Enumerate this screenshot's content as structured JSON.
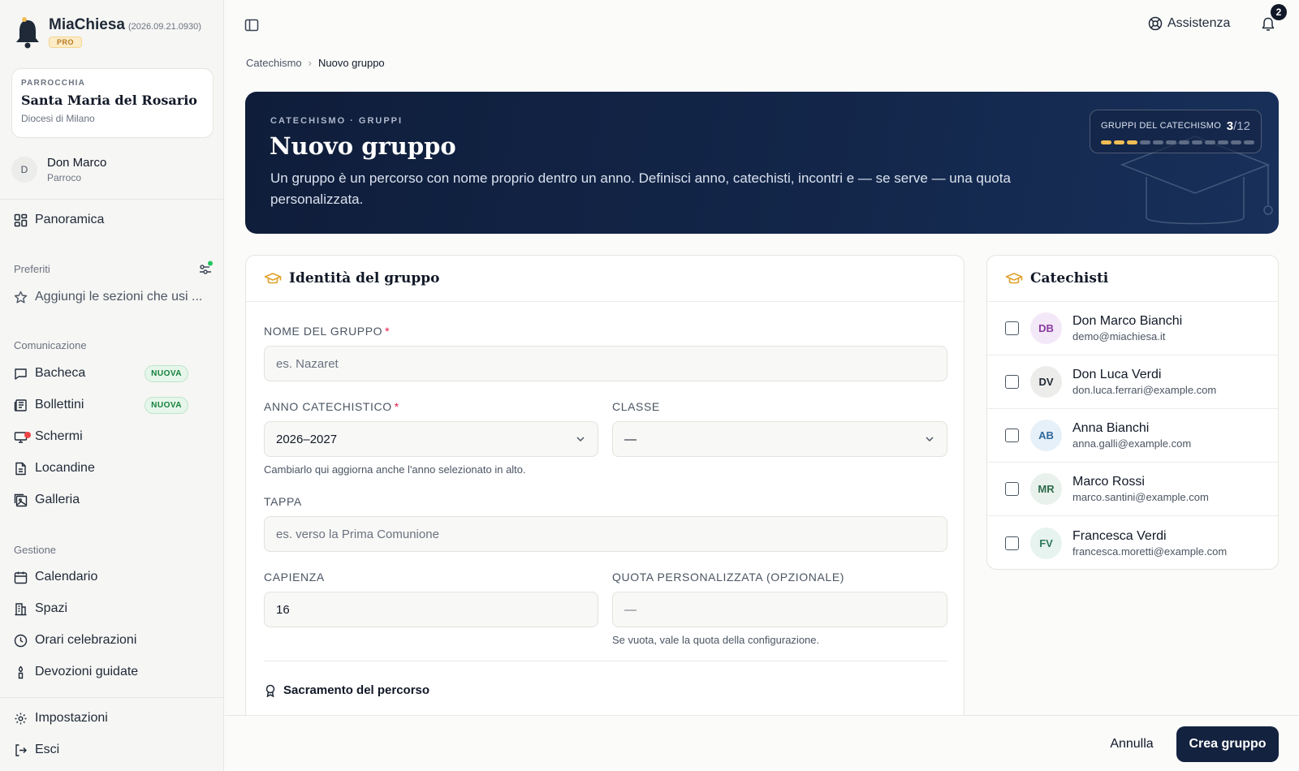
{
  "app": {
    "name": "MiaChiesa",
    "version": "(2026.09.21.0930)",
    "plan_badge": "PRO"
  },
  "parish": {
    "kicker": "PARROCCHIA",
    "name": "Santa Maria del Rosario",
    "diocese": "Diocesi di Milano"
  },
  "user": {
    "initial": "D",
    "name": "Don Marco",
    "role": "Parroco"
  },
  "nav": {
    "overview": "Panoramica",
    "favorites_label": "Preferiti",
    "favorites_add": "Aggiungi le sezioni che usi ...",
    "comms_label": "Comunicazione",
    "comms": [
      {
        "label": "Bacheca",
        "badge": "NUOVA"
      },
      {
        "label": "Bollettini",
        "badge": "NUOVA"
      },
      {
        "label": "Schermi"
      },
      {
        "label": "Locandine"
      },
      {
        "label": "Galleria"
      }
    ],
    "mgmt_label": "Gestione",
    "mgmt": [
      {
        "label": "Calendario"
      },
      {
        "label": "Spazi"
      },
      {
        "label": "Orari celebrazioni"
      },
      {
        "label": "Devozioni guidate"
      }
    ],
    "settings": "Impostazioni",
    "logout": "Esci"
  },
  "topbar": {
    "help": "Assistenza",
    "notifications": "2"
  },
  "breadcrumb": {
    "parent": "Catechismo",
    "current": "Nuovo gruppo"
  },
  "hero": {
    "kicker": "CATECHISMO · GRUPPI",
    "title": "Nuovo gruppo",
    "description": "Un gruppo è un percorso con nome proprio dentro un anno. Definisci anno, catechisti, incontri e — se serve — una quota personalizzata.",
    "counter_label": "GRUPPI DEL CATECHISMO",
    "counter_value": "3",
    "counter_total": "/12",
    "counter_used": 3,
    "counter_max": 12
  },
  "identity": {
    "title": "Identità del gruppo",
    "name_label": "NOME DEL GRUPPO",
    "name_placeholder": "es. Nazaret",
    "year_label": "ANNO CATECHISTICO",
    "year_value": "2026–2027",
    "year_hint": "Cambiarlo qui aggiorna anche l'anno selezionato in alto.",
    "class_label": "CLASSE",
    "class_value": "—",
    "stage_label": "TAPPA",
    "stage_placeholder": "es. verso la Prima Comunione",
    "capacity_label": "CAPIENZA",
    "capacity_value": "16",
    "quota_label": "QUOTA PERSONALIZZATA (OPZIONALE)",
    "quota_placeholder": "—",
    "quota_hint": "Se vuota, vale la quota della configurazione.",
    "sacrament_title": "Sacramento del percorso"
  },
  "catechists": {
    "title": "Catechisti",
    "items": [
      {
        "initials": "DB",
        "name": "Don Marco Bianchi",
        "email": "demo@miachiesa.it",
        "bg": "#f3e8f7",
        "fg": "#8b3aa3"
      },
      {
        "initials": "DV",
        "name": "Don Luca Verdi",
        "email": "don.luca.ferrari@example.com",
        "bg": "#ececea",
        "fg": "#1f2937"
      },
      {
        "initials": "AB",
        "name": "Anna Bianchi",
        "email": "anna.galli@example.com",
        "bg": "#e6f0f8",
        "fg": "#2f6a9b"
      },
      {
        "initials": "MR",
        "name": "Marco Rossi",
        "email": "marco.santini@example.com",
        "bg": "#e9f1ec",
        "fg": "#2e6a4a"
      },
      {
        "initials": "FV",
        "name": "Francesca Verdi",
        "email": "francesca.moretti@example.com",
        "bg": "#e7f3ee",
        "fg": "#2e7a5c"
      }
    ]
  },
  "actions": {
    "cancel": "Annulla",
    "create": "Crea gruppo"
  },
  "colors": {
    "navy": "#13223f",
    "accent": "#f1bd55",
    "success": "#15803d",
    "danger": "#e11d48"
  }
}
